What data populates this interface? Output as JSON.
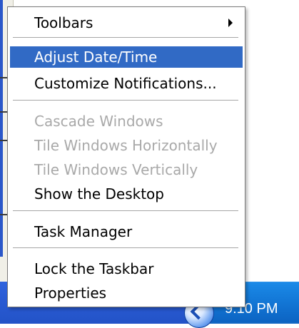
{
  "menu": {
    "items": [
      {
        "label": "Toolbars",
        "has_submenu": true
      },
      {
        "label": "Adjust Date/Time",
        "highlighted": true
      },
      {
        "label": "Customize Notifications..."
      },
      {
        "label": "Cascade Windows",
        "disabled": true
      },
      {
        "label": "Tile Windows Horizontally",
        "disabled": true
      },
      {
        "label": "Tile Windows Vertically",
        "disabled": true
      },
      {
        "label": "Show the Desktop"
      },
      {
        "label": "Task Manager"
      },
      {
        "label": "Lock the Taskbar"
      },
      {
        "label": "Properties"
      }
    ]
  },
  "taskbar": {
    "clock": "9:10 PM",
    "tray_icon": "show-hidden-icons-chevron"
  },
  "colors": {
    "highlight": "#316ac5",
    "taskbar": "#2a5bd4",
    "tray": "#1378d7",
    "disabled_text": "#a9a9a9"
  }
}
